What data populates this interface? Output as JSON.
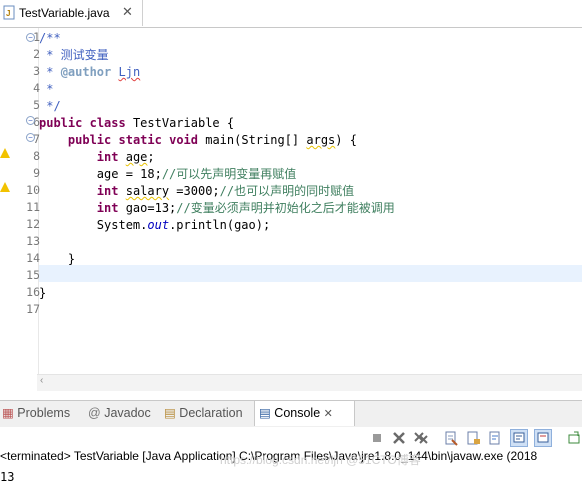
{
  "editor": {
    "tab_label": "TestVariable.java",
    "close_glyph": "✕",
    "line_numbers": [
      "1",
      "2",
      "3",
      "4",
      "5",
      "6",
      "7",
      "8",
      "9",
      "10",
      "11",
      "12",
      "13",
      "14",
      "15",
      "16",
      "17"
    ],
    "lines": {
      "l1": "/**",
      "l2": " * 测试变量",
      "l3_tag": "@author",
      "l3_name": "Ljn",
      "l4": " *",
      "l5": " */",
      "l6_kw1": "public",
      "l6_kw2": "class",
      "l6_rest": " TestVariable {",
      "l7_kw1": "public",
      "l7_kw2": "static",
      "l7_kw3": "void",
      "l7_rest": " main(String[] ",
      "l7_args": "args",
      "l7_end": ") {",
      "l8_kw": "int",
      "l8_var": "age",
      "l8_end": ";",
      "l9_code": "age = 18;",
      "l9_comment": "//可以先声明变量再赋值",
      "l10_kw": "int",
      "l10_var": "salary",
      "l10_code": " =3000;",
      "l10_comment": "//也可以声明的同时赋值",
      "l11_kw": "int",
      "l11_code": " gao=13;",
      "l11_comment": "//变量必须声明并初始化之后才能被调用",
      "l12_a": "System.",
      "l12_out": "out",
      "l12_b": ".println(gao);",
      "l14": "}",
      "l16": "}"
    }
  },
  "panel": {
    "tabs": {
      "problems": "Problems",
      "javadoc": "Javadoc",
      "declaration": "Declaration",
      "console": "Console"
    },
    "status": "<terminated> TestVariable [Java Application] C:\\Program Files\\Java\\jre1.8.0_144\\bin\\javaw.exe (2018",
    "output": "13",
    "watermark": "https://blog.csdn.net/ljn @51CTO博客"
  },
  "colors": {
    "keyword": "#7f0055",
    "comment": "#3f7f5f",
    "javadoc": "#3f5fbf",
    "field": "#0000c0",
    "current_line": "#e8f2fe"
  }
}
